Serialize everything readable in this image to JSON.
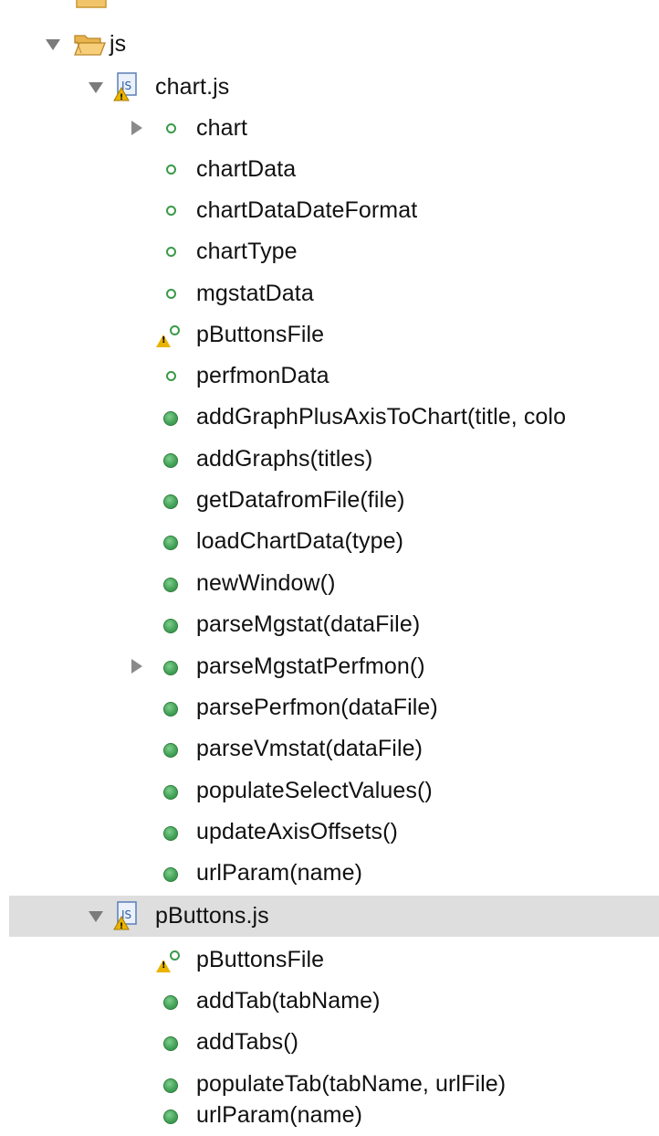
{
  "tree": {
    "partial_top_label": "...",
    "js_folder": {
      "label": "js",
      "expanded": true,
      "icon": "open-folder-icon"
    },
    "chart_file": {
      "label": "chart.js",
      "expanded": true,
      "icon": "js-file-warning-icon",
      "fields": [
        {
          "label": "chart",
          "expandable": true
        },
        {
          "label": "chartData"
        },
        {
          "label": "chartDataDateFormat"
        },
        {
          "label": "chartType"
        },
        {
          "label": "mgstatData"
        },
        {
          "label": "pButtonsFile",
          "warning": true
        },
        {
          "label": "perfmonData"
        }
      ],
      "methods": [
        {
          "label": "addGraphPlusAxisToChart(title, colo"
        },
        {
          "label": "addGraphs(titles)"
        },
        {
          "label": "getDatafromFile(file)"
        },
        {
          "label": "loadChartData(type)"
        },
        {
          "label": "newWindow()"
        },
        {
          "label": "parseMgstat(dataFile)"
        },
        {
          "label": "parseMgstatPerfmon()",
          "expandable": true
        },
        {
          "label": "parsePerfmon(dataFile)"
        },
        {
          "label": "parseVmstat(dataFile)"
        },
        {
          "label": "populateSelectValues()"
        },
        {
          "label": "updateAxisOffsets()"
        },
        {
          "label": "urlParam(name)"
        }
      ]
    },
    "pbuttons_file": {
      "label": "pButtons.js",
      "expanded": true,
      "selected": true,
      "icon": "js-file-warning-icon",
      "fields": [
        {
          "label": "pButtonsFile",
          "warning": true
        }
      ],
      "methods": [
        {
          "label": "addTab(tabName)"
        },
        {
          "label": "addTabs()"
        },
        {
          "label": "populateTab(tabName, urlFile)"
        },
        {
          "label": "urlParam(name)"
        }
      ]
    }
  },
  "colors": {
    "selection_bg": "#dedede",
    "field_icon": "#3a9a4a",
    "method_icon": "#46a45a",
    "warning": "#e8b400",
    "twisty": "#7b7b7b"
  }
}
